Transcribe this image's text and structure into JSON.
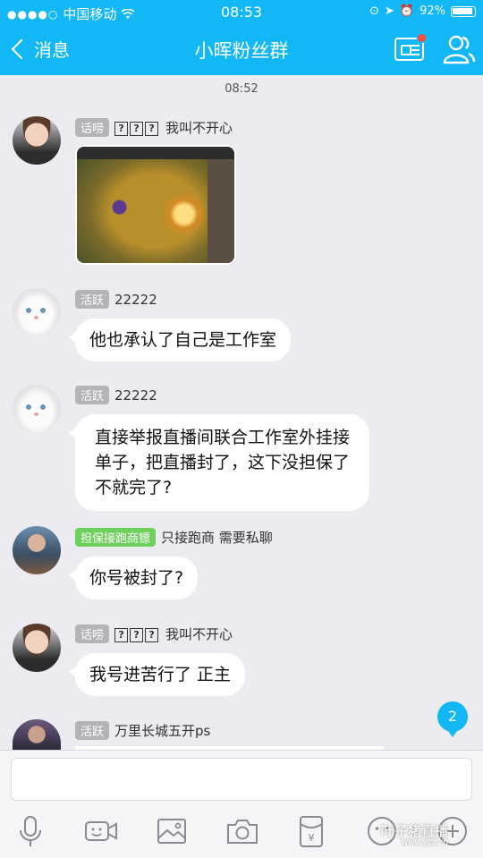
{
  "status_bar": {
    "carrier": "中国移动",
    "time": "08:53",
    "battery": "92%"
  },
  "nav": {
    "back_label": "消息",
    "title": "小晖粉丝群"
  },
  "timestamp": "08:52",
  "messages": [
    {
      "badge": "话唠",
      "sender": "我叫不开心",
      "type": "image"
    },
    {
      "badge": "活跃",
      "sender": "22222",
      "text": "他也承认了自己是工作室"
    },
    {
      "badge": "活跃",
      "sender": "22222",
      "text_lines": [
        "直接举报直播间联合工作室外挂接",
        "单子，把直播封了，这下没担保了",
        "不就完了?"
      ]
    },
    {
      "badge": "担保接跑商镖",
      "sender": "只接跑商 需要私聊",
      "text": "你号被封了?"
    },
    {
      "badge": "话唠",
      "sender": "我叫不开心",
      "text": "我号进苦行了 正主"
    },
    {
      "badge": "活跃",
      "sender": "万里长城五开ps"
    }
  ],
  "unread_count": "2",
  "watermark": {
    "main": "叶子猪直播",
    "sub": "www.yzz.cn"
  },
  "colors": {
    "accent": "#12b7f5",
    "badge_grey": "#b3b3b8",
    "badge_green": "#6fd05e",
    "notification_red": "#ff4c3b"
  },
  "toolbar_icons": [
    "microphone-icon",
    "video-icon",
    "image-icon",
    "camera-icon",
    "red-packet-icon",
    "emoji-icon",
    "more-icon"
  ]
}
